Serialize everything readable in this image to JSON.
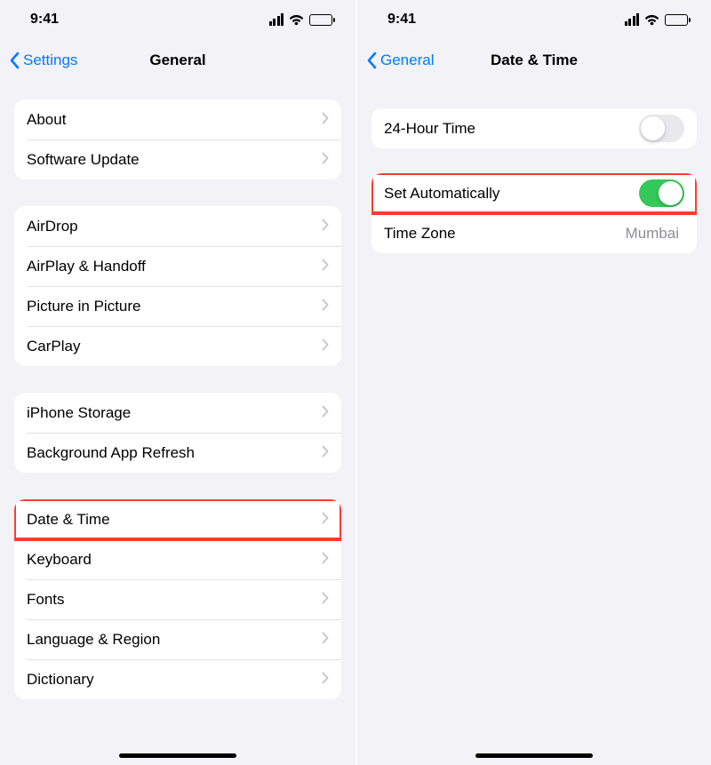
{
  "status": {
    "time": "9:41"
  },
  "left": {
    "back": "Settings",
    "title": "General",
    "groups": [
      [
        {
          "label": "About"
        },
        {
          "label": "Software Update"
        }
      ],
      [
        {
          "label": "AirDrop"
        },
        {
          "label": "AirPlay & Handoff"
        },
        {
          "label": "Picture in Picture"
        },
        {
          "label": "CarPlay"
        }
      ],
      [
        {
          "label": "iPhone Storage"
        },
        {
          "label": "Background App Refresh"
        }
      ],
      [
        {
          "label": "Date & Time"
        },
        {
          "label": "Keyboard"
        },
        {
          "label": "Fonts"
        },
        {
          "label": "Language & Region"
        },
        {
          "label": "Dictionary"
        }
      ]
    ],
    "highlighted_row": "Date & Time"
  },
  "right": {
    "back": "General",
    "title": "Date & Time",
    "rows": {
      "twenty_four_hour": {
        "label": "24-Hour Time",
        "on": false
      },
      "set_automatically": {
        "label": "Set Automatically",
        "on": true
      },
      "time_zone": {
        "label": "Time Zone",
        "value": "Mumbai"
      }
    },
    "highlighted_row": "Set Automatically"
  },
  "colors": {
    "accent": "#007aff",
    "highlight": "#ff3b30",
    "toggle_on": "#34c759",
    "background": "#f2f2f7"
  }
}
